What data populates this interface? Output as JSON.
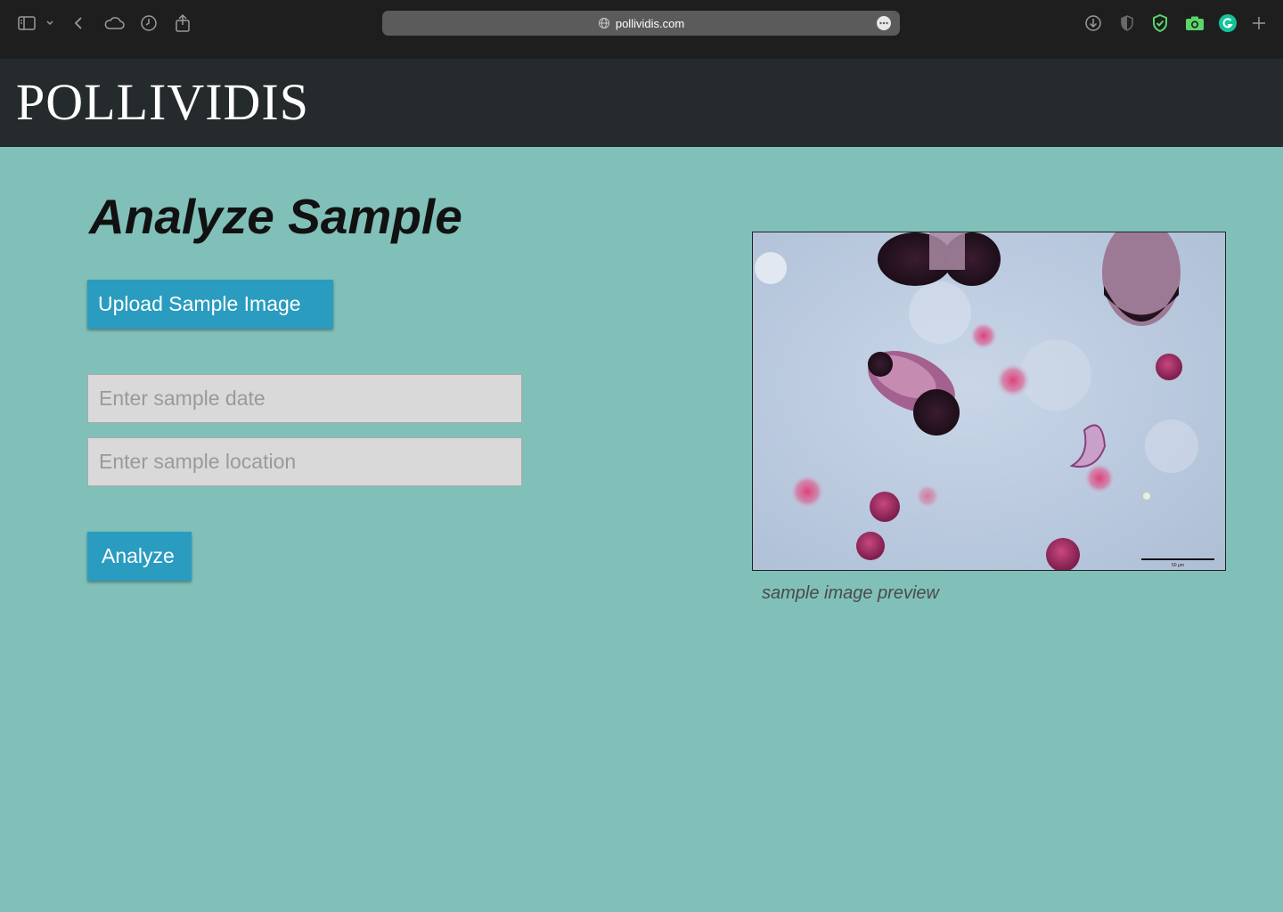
{
  "browser": {
    "url": "pollividis.com",
    "icons": [
      "sidebar-icon",
      "chevron-down-icon",
      "back-icon",
      "cloud-icon",
      "history-icon",
      "share-icon",
      "globe-icon",
      "more-icon",
      "download-icon",
      "shield-icon",
      "adblock-icon",
      "camera-icon",
      "grammarly-icon",
      "plus-icon"
    ]
  },
  "header": {
    "logo": "POLLIVIDIS"
  },
  "main": {
    "title": "Analyze Sample",
    "upload_label": "Upload Sample Image",
    "date_placeholder": "Enter sample date",
    "date_value": "",
    "location_placeholder": "Enter sample location",
    "location_value": "",
    "analyze_label": "Analyze"
  },
  "preview": {
    "caption": "sample image preview"
  },
  "colors": {
    "page_bg": "#80c0b9",
    "header_bg": "#252a2c",
    "button_bg": "#2a9cc0",
    "chrome_bg": "#1e1e1e"
  }
}
